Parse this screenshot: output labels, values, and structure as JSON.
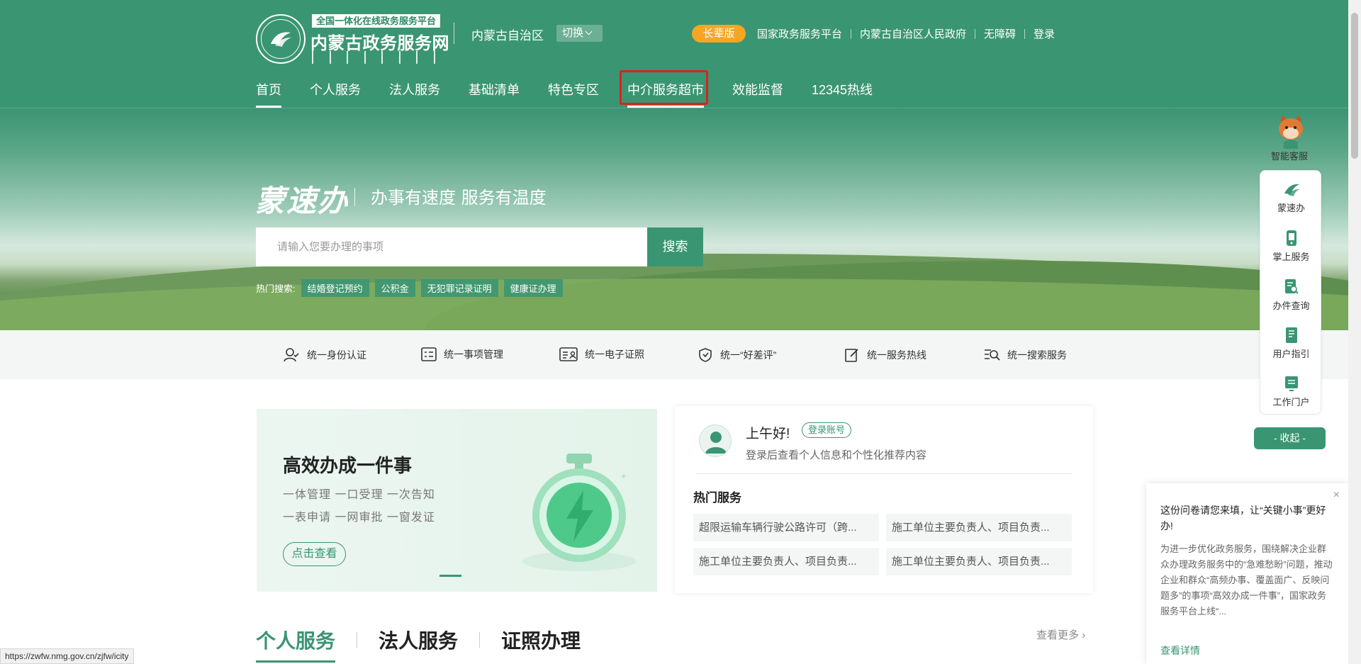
{
  "header": {
    "logo_tagline": "全国一体化在线政务服务平台",
    "logo_title": "内蒙古政务服务网",
    "region": "内蒙古自治区",
    "switch_label": "切换",
    "elder_mode": "长辈版",
    "top_links": [
      "国家政务服务平台",
      "内蒙古自治区人民政府",
      "无障碍",
      "登录"
    ],
    "nav": [
      "首页",
      "个人服务",
      "法人服务",
      "基础清单",
      "特色专区",
      "中介服务超市",
      "效能监督",
      "12345热线"
    ]
  },
  "hero": {
    "brand": "蒙速办",
    "slogan": "办事有速度  服务有温度",
    "search_placeholder": "请输入您要办理的事项",
    "search_button": "搜索",
    "hot_label": "热门搜索:",
    "hot_tags": [
      "结婚登记预约",
      "公积金",
      "无犯罪记录证明",
      "健康证办理"
    ]
  },
  "features": [
    "统一身份认证",
    "统一事项管理",
    "统一电子证照",
    "统一“好差评”",
    "统一服务热线",
    "统一搜索服务"
  ],
  "banner": {
    "title": "高效办成一件事",
    "line1": "一体管理 一口受理 一次告知",
    "line2": "一表申请 一网审批 一窗发证",
    "button": "点击查看"
  },
  "user_card": {
    "greeting": "上午好!",
    "login_tag": "登录账号",
    "subtitle": "登录后查看个人信息和个性化推荐内容",
    "hot_title": "热门服务",
    "services": [
      "超限运输车辆行驶公路许可（跨...",
      "施工单位主要负责人、项目负责...",
      "施工单位主要负责人、项目负责...",
      "施工单位主要负责人、项目负责..."
    ]
  },
  "tabs": [
    "个人服务",
    "法人服务",
    "证照办理"
  ],
  "more_label": "查看更多",
  "float_bar": {
    "cs_label": "智能客服",
    "items": [
      "蒙速办",
      "掌上服务",
      "办件查询",
      "用户指引",
      "工作门户"
    ],
    "collapse": "- 收起 -"
  },
  "popup": {
    "close": "×",
    "title": "这份问卷请您来填，让“关键小事”更好办!",
    "body": "为进一步优化政务服务，围绕解决企业群众办理政务服务中的“急难愁盼”问题，推动企业和群众“高频办事、覆盖面广、反映问题多”的事项“高效办成一件事”，国家政务服务平台上线“...",
    "link": "查看详情"
  },
  "status_url": "https://zwfw.nmg.gov.cn/zjfw/icity",
  "colors": {
    "brand_green": "#3a9573",
    "elder_orange": "#f5a623",
    "highlight_red": "#e0201a"
  }
}
